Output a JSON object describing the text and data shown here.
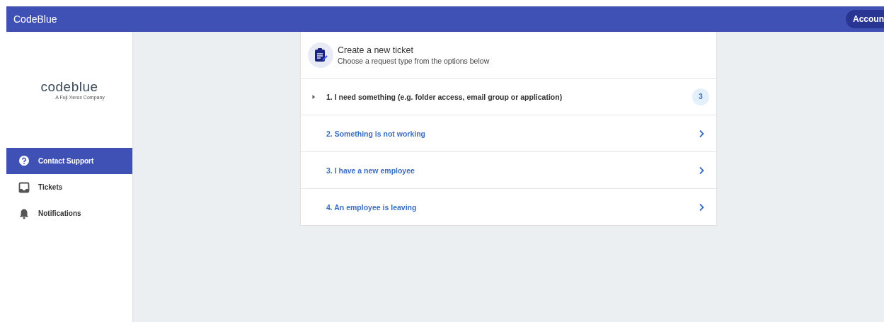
{
  "app_bar": {
    "title": "CodeBlue",
    "account_button": "Accoun"
  },
  "sidebar": {
    "logo": {
      "wordmark": "codeblue",
      "tagline": "A Fuji Xerox Company"
    },
    "items": [
      {
        "label": "Contact Support",
        "kind": "help",
        "selected": true
      },
      {
        "label": "Tickets",
        "kind": "inbox",
        "selected": false
      },
      {
        "label": "Notifications",
        "kind": "bell",
        "selected": false
      }
    ]
  },
  "card": {
    "title": "Create a new ticket",
    "subtitle": "Choose a request type from the options below",
    "options": [
      {
        "kind": "expandable",
        "label": "1. I need something (e.g. folder access, email group or application)",
        "count": "3",
        "expanded": false
      },
      {
        "kind": "link",
        "label": "2. Something is not working"
      },
      {
        "kind": "link",
        "label": "3. I have a new employee"
      },
      {
        "kind": "link",
        "label": "4. An employee is leaving"
      }
    ]
  }
}
